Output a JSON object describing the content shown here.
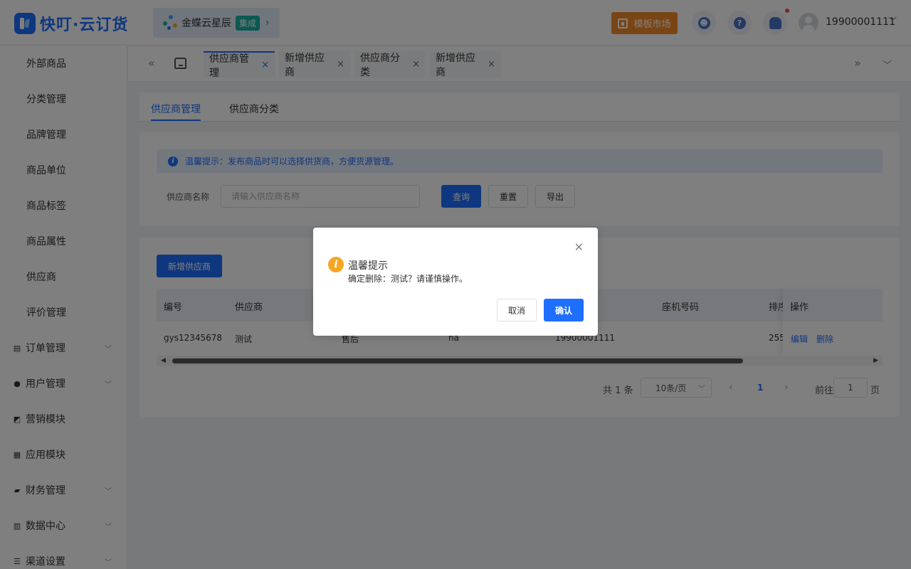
{
  "header": {
    "logo_text": "快叮·云订货",
    "erp": {
      "name": "金蝶云星辰",
      "tag": "集成",
      "arrow": "›"
    },
    "market_label": "模板市场",
    "user_phone": "19900001111",
    "user_caret": "﹀"
  },
  "sidebar": {
    "sub_items": [
      "外部商品",
      "分类管理",
      "品牌管理",
      "商品单位",
      "商品标签",
      "商品属性",
      "供应商",
      "评价管理"
    ],
    "groups": [
      {
        "label": "订单管理",
        "icon": "clipboard-icon",
        "expand": true
      },
      {
        "label": "用户管理",
        "icon": "person-icon",
        "expand": true
      },
      {
        "label": "营销模块",
        "icon": "chart-line-icon",
        "expand": false
      },
      {
        "label": "应用模块",
        "icon": "grid-icon",
        "expand": false
      },
      {
        "label": "财务管理",
        "icon": "wallet-icon",
        "expand": true
      },
      {
        "label": "数据中心",
        "icon": "bar-chart-icon",
        "expand": true
      },
      {
        "label": "渠道设置",
        "icon": "list-icon",
        "expand": true
      }
    ]
  },
  "tabbar": {
    "tabs": [
      {
        "label": "供应商管理",
        "active": true
      },
      {
        "label": "新增供应商",
        "active": false
      },
      {
        "label": "供应商分类",
        "active": false
      },
      {
        "label": "新增供应商",
        "active": false
      }
    ],
    "close_glyph": "×"
  },
  "subtabs": {
    "manage": "供应商管理",
    "category": "供应商分类"
  },
  "notice": "温馨提示：发布商品时可以选择供货商，方便货源管理。",
  "filter": {
    "label": "供应商名称",
    "placeholder": "请输入供应商名称",
    "query": "查询",
    "reset": "重置",
    "export": "导出"
  },
  "table": {
    "add_button": "新增供应商",
    "headers": {
      "code": "编号",
      "supplier": "供应商",
      "landline": "座机号码",
      "sort": "排序",
      "ops": "操作"
    },
    "row": {
      "code": "gys12345678",
      "supplier": "测试",
      "col3": "售后",
      "col4": "ha",
      "phone": "19900001111",
      "sort": "255",
      "edit": "编辑",
      "delete": "删除"
    }
  },
  "pagination": {
    "total": "共 1 条",
    "page_size": "10条/页",
    "current": "1",
    "goto_label": "前往",
    "goto_value": "1",
    "page_suffix": "页"
  },
  "dialog": {
    "title": "温馨提示",
    "message": "确定删除：测试？请谨慎操作。",
    "cancel": "取消",
    "confirm": "确认"
  },
  "colors": {
    "primary": "#1f6fff",
    "warning": "#f5a623",
    "market": "#f48b2a",
    "erp_tag": "#16b3a2"
  }
}
